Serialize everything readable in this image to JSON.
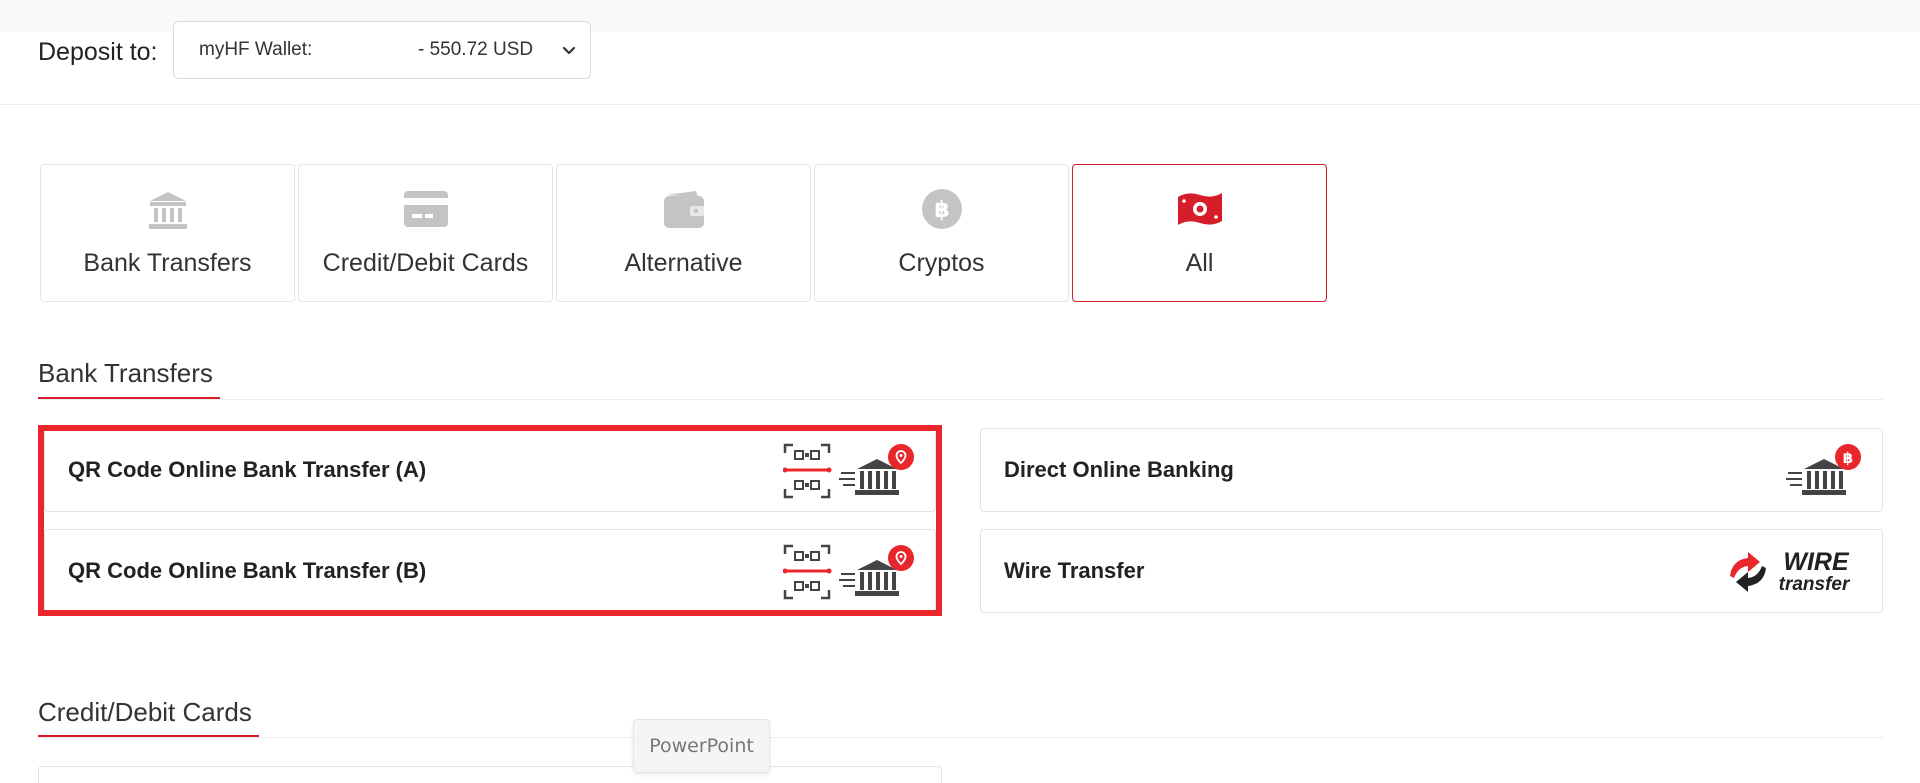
{
  "deposit": {
    "label": "Deposit to:",
    "wallet_name": "myHF Wallet:",
    "wallet_amount": "- 550.72 USD",
    "chevron_icon": "chevron-down-icon"
  },
  "tabs": [
    {
      "label": "Bank Transfers",
      "icon": "bank-icon",
      "active": false
    },
    {
      "label": "Credit/Debit Cards",
      "icon": "credit-card-icon",
      "active": false
    },
    {
      "label": "Alternative",
      "icon": "wallet-icon",
      "active": false
    },
    {
      "label": "Cryptos",
      "icon": "bitcoin-icon",
      "active": false
    },
    {
      "label": "All",
      "icon": "cash-icon",
      "active": true
    }
  ],
  "sections": {
    "bank_transfers": {
      "title": "Bank Transfers",
      "methods": [
        {
          "name": "QR Code Online Bank Transfer (A)",
          "logo": "qr-bank-logo"
        },
        {
          "name": "QR Code Online Bank Transfer (B)",
          "logo": "qr-bank-logo"
        },
        {
          "name": "Direct Online Banking",
          "logo": "bank-bitcoin-logo"
        },
        {
          "name": "Wire Transfer",
          "logo": "wire-transfer-logo",
          "logo_text_1": "WIRE",
          "logo_text_2": "transfer"
        }
      ]
    },
    "credit_debit_cards": {
      "title": "Credit/Debit Cards"
    }
  },
  "tooltip": {
    "text": "PowerPoint"
  },
  "colors": {
    "accent": "#d51e2a",
    "icon_gray": "#c4c4c4",
    "highlight": "#e8262b",
    "text": "#333333"
  }
}
